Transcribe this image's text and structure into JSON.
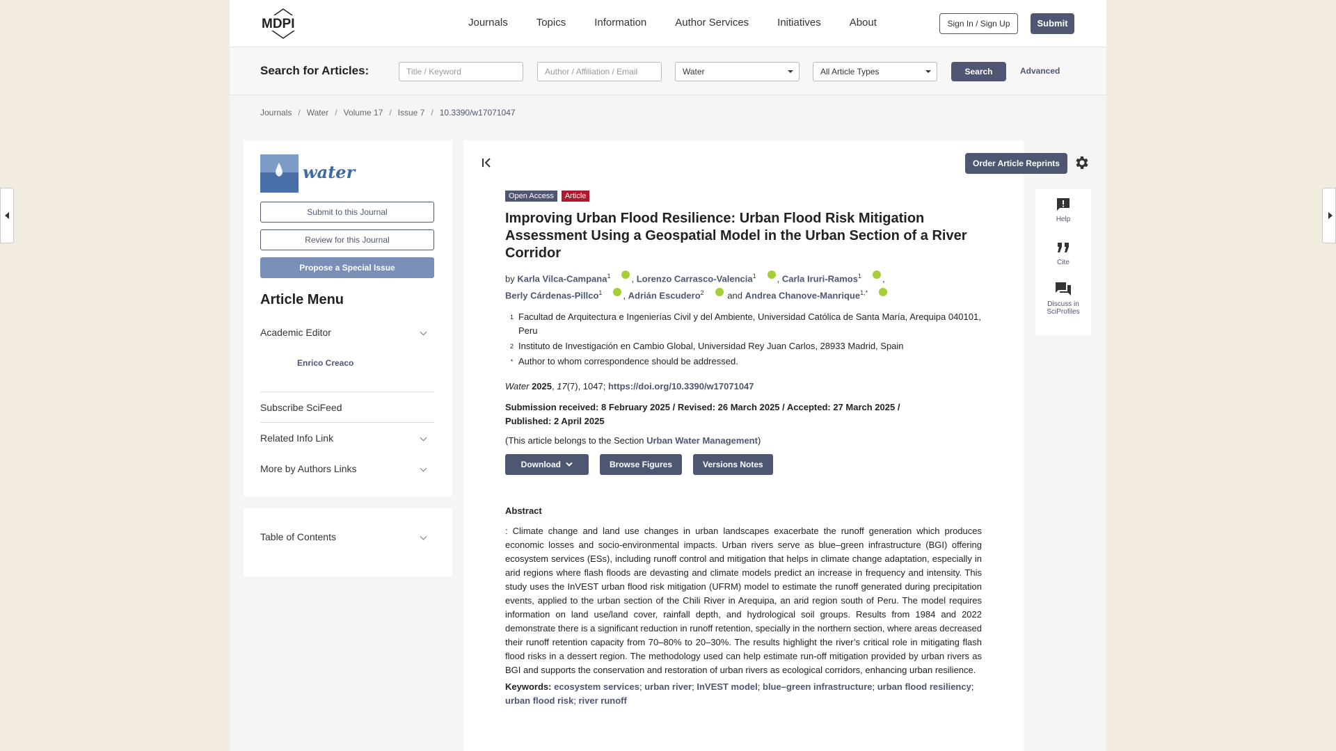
{
  "header": {
    "logo_text": "MDPI",
    "nav": [
      "Journals",
      "Topics",
      "Information",
      "Author Services",
      "Initiatives",
      "About"
    ],
    "signin_label": "Sign In / Sign Up",
    "submit_label": "Submit"
  },
  "search": {
    "label": "Search for Articles:",
    "title_placeholder": "Title / Keyword",
    "author_placeholder": "Author / Affiliation / Email",
    "journal_value": "Water",
    "type_value": "All Article Types",
    "search_label": "Search",
    "advanced_label": "Advanced"
  },
  "breadcrumb": [
    "Journals",
    "Water",
    "Volume 17",
    "Issue 7",
    "10.3390/w17071047"
  ],
  "sidebar": {
    "journal_name": "water",
    "submit_label": "Submit to this Journal",
    "review_label": "Review for this Journal",
    "propose_label": "Propose a Special Issue",
    "menu_title": "Article Menu",
    "academic_editor_label": "Academic Editor",
    "editor_name": "Enrico Creaco",
    "subscribe_label": "Subscribe SciFeed",
    "related_label": "Related Info Link",
    "more_label": "More by Authors Links",
    "toc_label": "Table of Contents"
  },
  "toolbar": {
    "reprints_label": "Order Article Reprints"
  },
  "article": {
    "open_access": "Open Access",
    "type": "Article",
    "title": "Improving Urban Flood Resilience: Urban Flood Risk Mitigation Assessment Using a Geospatial Model in the Urban Section of a River Corridor",
    "by": "by",
    "authors": [
      {
        "name": "Karla Vilca-Campana",
        "sup": "1"
      },
      {
        "name": "Lorenzo Carrasco-Valencia",
        "sup": "1"
      },
      {
        "name": "Carla Iruri-Ramos",
        "sup": "1"
      },
      {
        "name": "Berly Cárdenas-Pillco",
        "sup": "1"
      },
      {
        "name": "Adrián Escudero",
        "sup": "2"
      },
      {
        "name": "Andrea Chanove-Manrique",
        "sup": "1,*"
      }
    ],
    "and_word": "and",
    "affiliations": [
      {
        "num": "1",
        "text": "Facultad de Arquitectura e Ingenierías Civil y del Ambiente, Universidad Católica de Santa María, Arequipa 040101, Peru"
      },
      {
        "num": "2",
        "text": "Instituto de Investigación en Cambio Global, Universidad Rey Juan Carlos, 28933 Madrid, Spain"
      },
      {
        "num": "*",
        "text": "Author to whom correspondence should be addressed."
      }
    ],
    "cite_journal": "Water",
    "cite_year": "2025",
    "cite_vol": "17",
    "cite_rest": "(7), 1047;",
    "doi": "https://doi.org/10.3390/w17071047",
    "dates": "Submission received: 8 February 2025 / Revised: 26 March 2025 / Accepted: 27 March 2025 / Published: 2 April 2025",
    "section_prefix": "(This article belongs to the Section",
    "section_name": "Urban Water Management",
    "section_suffix": ")",
    "download_label": "Download",
    "figures_label": "Browse Figures",
    "versions_label": "Versions Notes",
    "abstract_title": "Abstract",
    "abstract_text": ": Climate change and land use changes in urban landscapes exacerbate the runoff generation which produces economic losses and socio-environmental impacts. Urban rivers serve as blue–green infrastructure (BGI) offering ecosystem services (ESs), including runoff control and mitigation that helps in climate change adaptation, especially in arid regions where flash floods are devasting and climate models predict an increase in frequency and intensity. This study uses the InVEST urban flood risk mitigation (UFRM) model to estimate the runoff generated during precipitation events, applied to the urban section of the Chili River in Arequipa, an arid region south of Peru. The model requires information on land use/land cover, rainfall depth, and hydrological soil groups. Results from 1984 and 2022 demonstrate there is a significant reduction in runoff retention, specially in the northern section, where areas decreased their runoff retention capacity from 70–80% to 20–30%. The results highlight the river’s critical role in mitigating flash flood risks in a dessert region. The methodology used can help estimate run-off mitigation provided by urban rivers as BGI and supports the conservation and restoration of urban rivers as ecological corridors, enhancing urban resilience.",
    "keywords_label": "Keywords:",
    "keywords": [
      "ecosystem services",
      "urban river",
      "InVEST model",
      "blue–green infrastructure",
      "urban flood resiliency",
      "urban flood risk",
      "river runoff"
    ]
  },
  "tools": [
    {
      "label": "Help",
      "icon": "help-icon"
    },
    {
      "label": "Cite",
      "icon": "quote-icon"
    },
    {
      "label": "Discuss in SciProfiles",
      "icon": "discuss-icon"
    }
  ],
  "colors": {
    "accent": "#4f5671",
    "article_tag": "#b1172f",
    "orcid": "#a6ce39"
  }
}
